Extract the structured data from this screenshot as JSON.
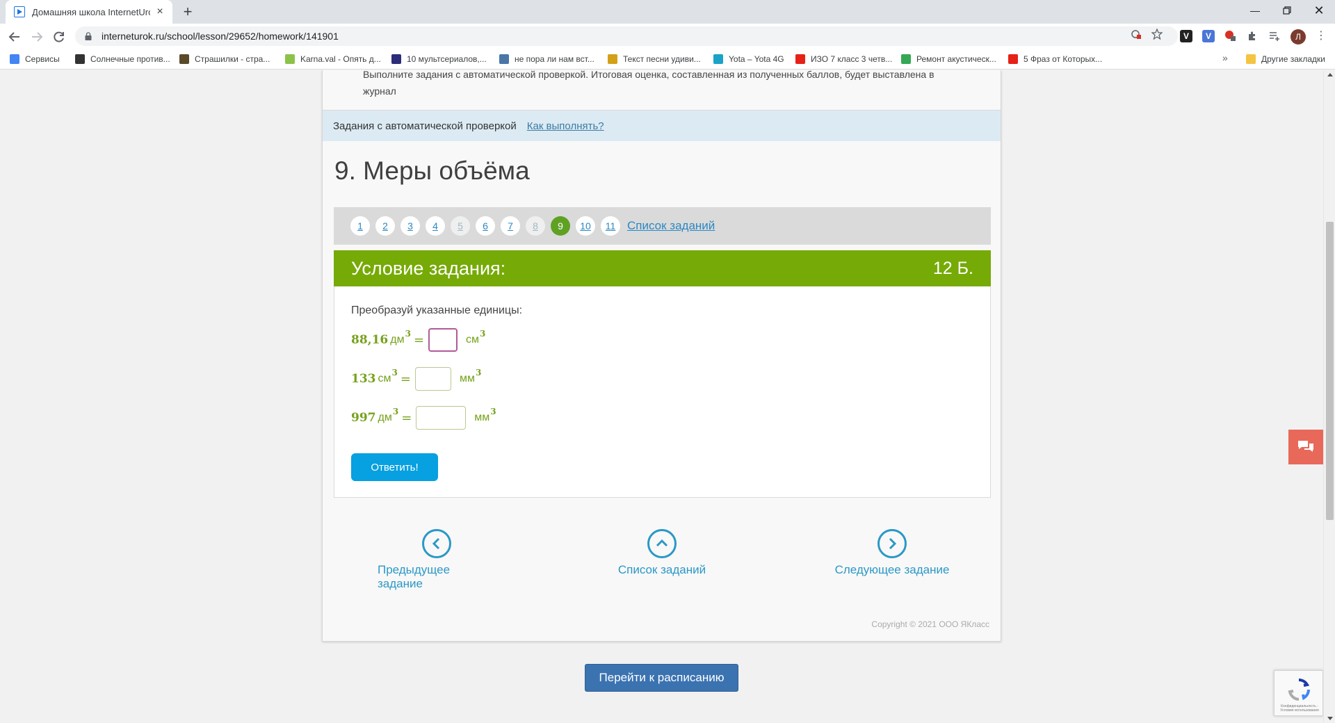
{
  "browser": {
    "tab_title": "Домашняя школа InternetUrok.ru",
    "url": "interneturok.ru/school/lesson/29652/homework/141901",
    "bookmarks": [
      {
        "label": "Сервисы",
        "color": "#4285f4"
      },
      {
        "label": "Солнечные против...",
        "color": "#333333"
      },
      {
        "label": "Страшилки - стра...",
        "color": "#5a4a2a"
      },
      {
        "label": "Karna.val - Опять д...",
        "color": "#8bc34a"
      },
      {
        "label": "10 мультсериалов,...",
        "color": "#2c2c7a"
      },
      {
        "label": "не пора ли нам вст...",
        "color": "#4a76a8"
      },
      {
        "label": "Текст песни удиви...",
        "color": "#d4a017"
      },
      {
        "label": "Yota – Yota 4G",
        "color": "#1aa3c7"
      },
      {
        "label": "ИЗО 7 класс 3 четв...",
        "color": "#e62117"
      },
      {
        "label": "Ремонт акустическ...",
        "color": "#34a853"
      },
      {
        "label": "5 Фраз от Которых...",
        "color": "#e62117"
      }
    ],
    "other_bookmarks": "Другие закладки",
    "profile_initial": "Л"
  },
  "page": {
    "intro_text": "Выполните задания с автоматической проверкой. Итоговая оценка, составленная из полученных баллов, будет выставлена в журнал",
    "auto_check_label": "Задания с автоматической проверкой",
    "how_link": "Как выполнять?",
    "title": "9. Меры объёма",
    "task_numbers": [
      "1",
      "2",
      "3",
      "4",
      "5",
      "6",
      "7",
      "8",
      "9",
      "10",
      "11"
    ],
    "active_task": "9",
    "task_list_link": "Список заданий",
    "condition_title": "Условие задания:",
    "points": "12 Б.",
    "instruction": "Преобразуй указанные единицы:",
    "equations": [
      {
        "value": "88,16",
        "from_unit": "дм",
        "exp": "3",
        "to_unit": "см",
        "input_value": ""
      },
      {
        "value": "133",
        "from_unit": "см",
        "exp": "3",
        "to_unit": "мм",
        "input_value": ""
      },
      {
        "value": "997",
        "from_unit": "дм",
        "exp": "3",
        "to_unit": "мм",
        "input_value": ""
      }
    ],
    "equals_sign": "=",
    "answer_button": "Ответить!",
    "prev_task": "Предыдущее задание",
    "task_list": "Список заданий",
    "next_task": "Следующее задание",
    "copyright": "Copyright © 2021 ООО ЯКласс",
    "schedule_button": "Перейти к расписанию",
    "recaptcha_text": "Конфиденциальность - Условия использования"
  },
  "colors": {
    "green_accent": "#76aa06",
    "active_number": "#5fa123",
    "link_blue": "#2b88c4",
    "answer_button": "#07a0e0",
    "schedule_button": "#3b73b1",
    "chat_button": "#e8695a"
  }
}
